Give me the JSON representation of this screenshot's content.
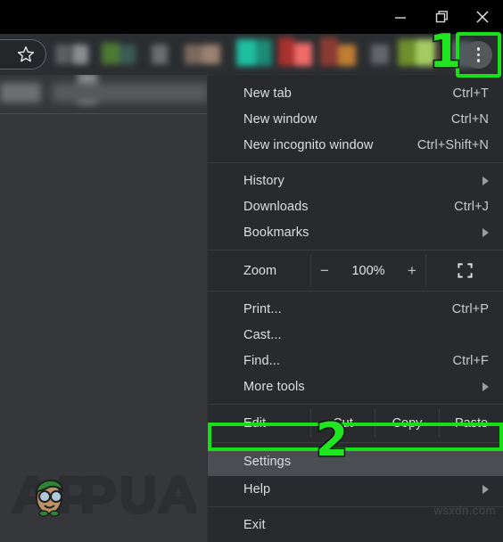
{
  "window": {
    "controls": [
      {
        "name": "minimize",
        "glyph": "minimize-icon"
      },
      {
        "name": "restore",
        "glyph": "restore-icon"
      },
      {
        "name": "close",
        "glyph": "close-icon"
      }
    ]
  },
  "toolbar": {
    "bookmark_star_icon": "star-icon",
    "menu_button_icon": "three-dot-menu-icon"
  },
  "markers": {
    "step_one": "1",
    "step_two": "2",
    "highlight_color": "#17e017",
    "marker_color": "#21e521"
  },
  "menu": {
    "groups": [
      {
        "items": [
          {
            "label": "New tab",
            "accel": "Ctrl+T",
            "arrow": false
          },
          {
            "label": "New window",
            "accel": "Ctrl+N",
            "arrow": false
          },
          {
            "label": "New incognito window",
            "accel": "Ctrl+Shift+N",
            "arrow": false
          }
        ]
      },
      {
        "items": [
          {
            "label": "History",
            "accel": "",
            "arrow": true
          },
          {
            "label": "Downloads",
            "accel": "Ctrl+J",
            "arrow": false
          },
          {
            "label": "Bookmarks",
            "accel": "",
            "arrow": true
          }
        ]
      },
      {
        "zoom": {
          "label": "Zoom",
          "minus": "−",
          "percent": "100%",
          "plus": "+",
          "fullscreen_icon": "fullscreen-icon"
        }
      },
      {
        "items": [
          {
            "label": "Print...",
            "accel": "Ctrl+P",
            "arrow": false
          },
          {
            "label": "Cast...",
            "accel": "",
            "arrow": false
          },
          {
            "label": "Find...",
            "accel": "Ctrl+F",
            "arrow": false
          },
          {
            "label": "More tools",
            "accel": "",
            "arrow": true
          }
        ]
      },
      {
        "edit": {
          "label": "Edit",
          "cut": "Cut",
          "copy": "Copy",
          "paste": "Paste"
        }
      },
      {
        "items": [
          {
            "label": "Settings",
            "accel": "",
            "arrow": false,
            "highlighted": true
          },
          {
            "label": "Help",
            "accel": "",
            "arrow": true
          }
        ]
      },
      {
        "items": [
          {
            "label": "Exit",
            "accel": "",
            "arrow": false
          }
        ]
      }
    ]
  },
  "branding": {
    "logo_text": "APPUALS",
    "logo_icon": "appuals-mascot-icon"
  },
  "watermark": {
    "text": "wsxdn.com"
  },
  "colors": {
    "menu_bg": "#292a2d",
    "page_bg": "#35373a",
    "toolbar_bg": "#2b2e31",
    "titlebar_bg": "#000000",
    "highlight_row": "#4a4d51",
    "text": "#dcdee0"
  }
}
